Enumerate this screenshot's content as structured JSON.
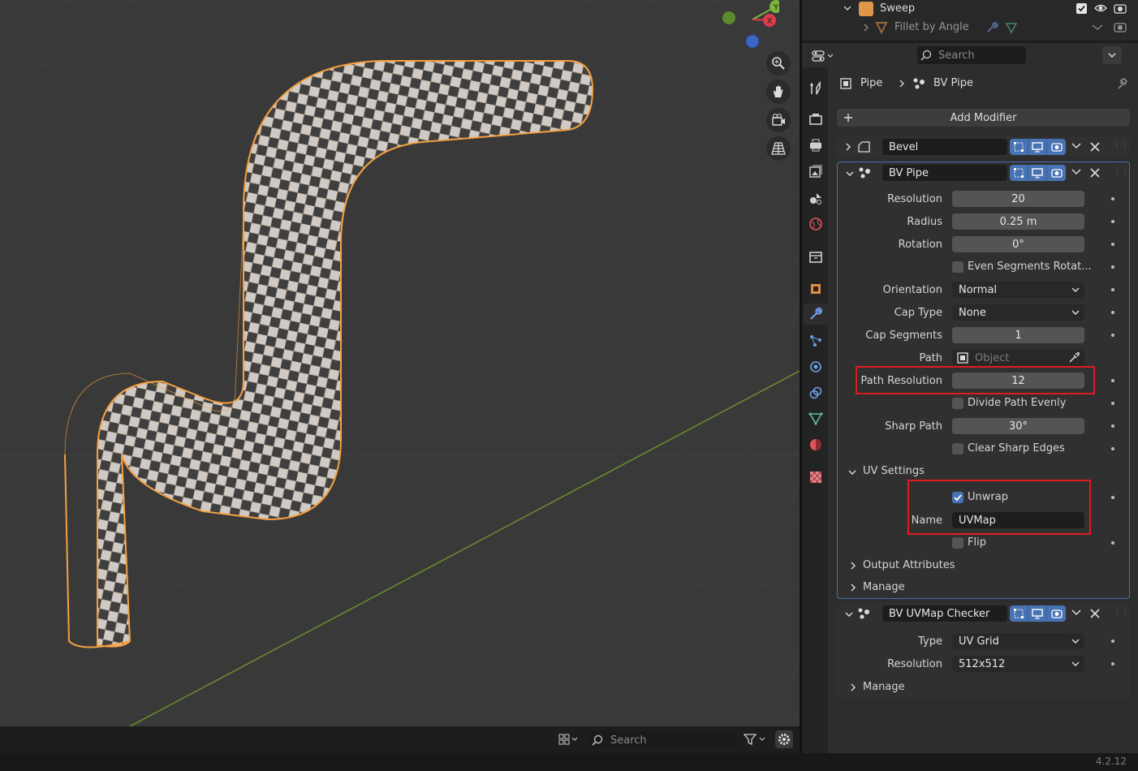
{
  "outliner": {
    "row1_label": "Sweep",
    "row2_label": "Fillet by Angle"
  },
  "header": {
    "search_placeholder": "Search"
  },
  "breadcrumb": {
    "object": "Pipe",
    "modifier": "BV Pipe"
  },
  "add_modifier_label": "Add Modifier",
  "modifiers": [
    {
      "name": "Bevel",
      "expanded": false
    },
    {
      "name": "BV Pipe",
      "expanded": true
    },
    {
      "name": "BV UVMap Checker",
      "expanded": true
    }
  ],
  "bvpipe": {
    "resolution": {
      "label": "Resolution",
      "value": "20"
    },
    "radius": {
      "label": "Radius",
      "value": "0.25 m"
    },
    "rotation": {
      "label": "Rotation",
      "value": "0°"
    },
    "even_segments": {
      "label": "Even Segments Rotat...",
      "checked": false
    },
    "orientation": {
      "label": "Orientation",
      "value": "Normal"
    },
    "cap_type": {
      "label": "Cap Type",
      "value": "None"
    },
    "cap_segments": {
      "label": "Cap Segments",
      "value": "1"
    },
    "path": {
      "label": "Path",
      "placeholder": "Object"
    },
    "path_resolution": {
      "label": "Path Resolution",
      "value": "12"
    },
    "divide_path": {
      "label": "Divide Path Evenly",
      "checked": false
    },
    "sharp_path": {
      "label": "Sharp Path",
      "value": "30°"
    },
    "clear_sharp": {
      "label": "Clear Sharp Edges",
      "checked": false
    },
    "uv_settings": {
      "title": "UV Settings",
      "unwrap": {
        "label": "Unwrap",
        "checked": true
      },
      "name": {
        "label": "Name",
        "value": "UVMap"
      },
      "flip": {
        "label": "Flip",
        "checked": false
      }
    },
    "output_attributes": "Output Attributes",
    "manage": "Manage"
  },
  "checker": {
    "type": {
      "label": "Type",
      "value": "UV Grid"
    },
    "resolution": {
      "label": "Resolution",
      "value": "512x512"
    },
    "manage": "Manage"
  },
  "footer": {
    "search_placeholder": "Search"
  },
  "version": "4.2.12",
  "gizmo": {
    "y": "Y",
    "x": "X"
  },
  "colors": {
    "accent": "#4772b3",
    "selection": "#f5a142",
    "highlight_box": "#e01b24"
  }
}
